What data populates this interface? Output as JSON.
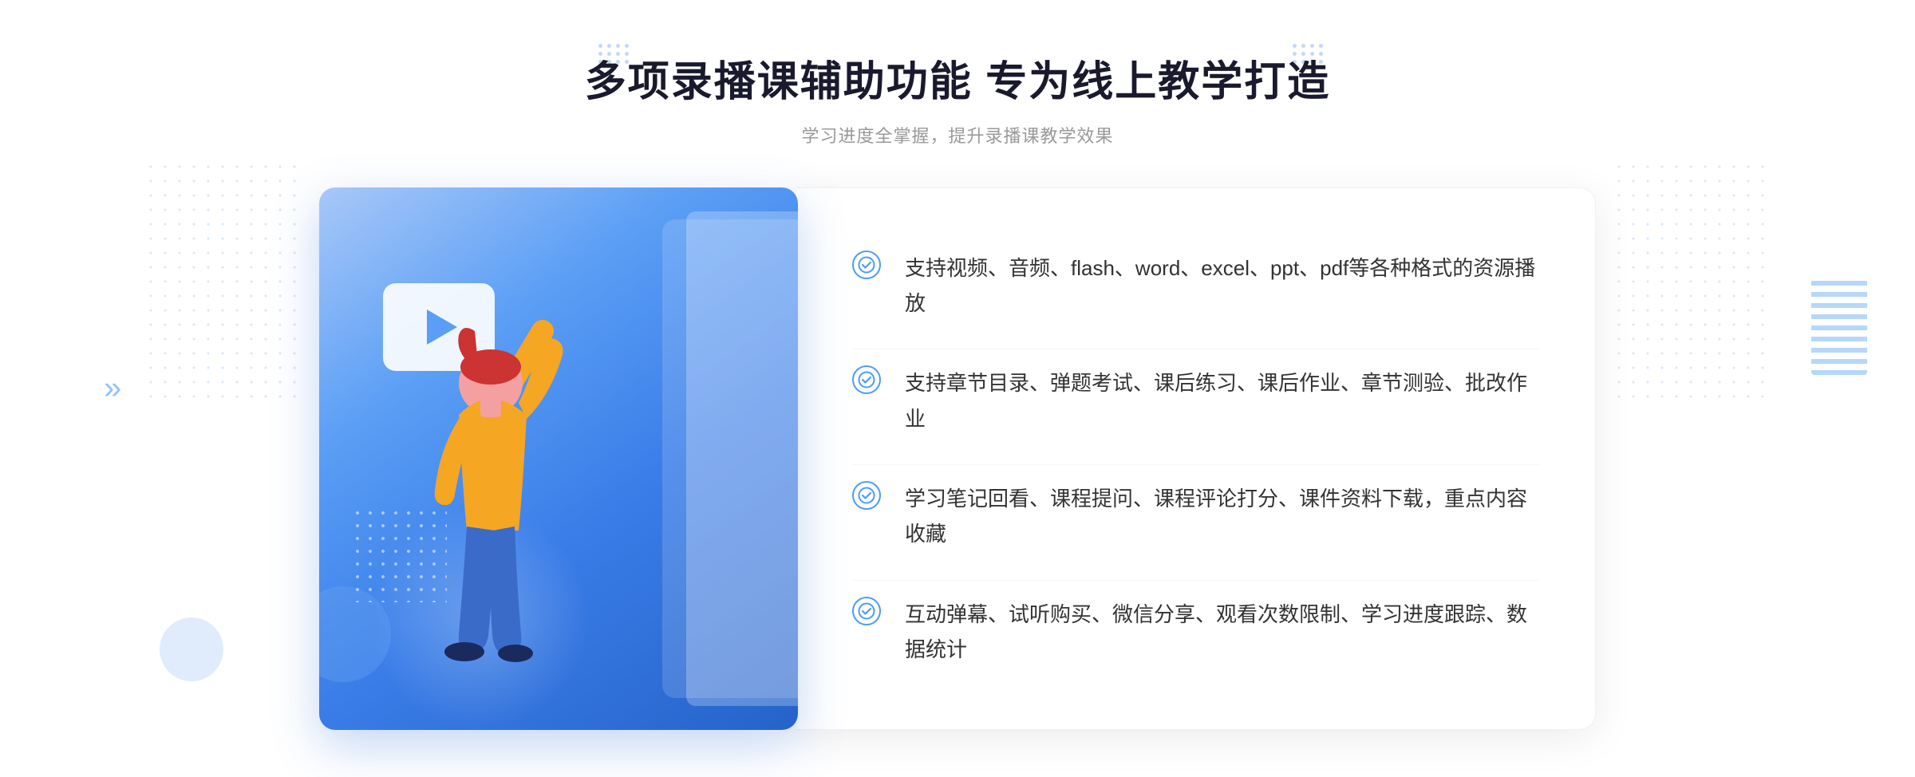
{
  "page": {
    "title": "多项录播课辅助功能 专为线上教学打造",
    "subtitle": "学习进度全掌握，提升录播课教学效果",
    "features": [
      {
        "id": "feature-1",
        "text": "支持视频、音频、flash、word、excel、ppt、pdf等各种格式的资源播放"
      },
      {
        "id": "feature-2",
        "text": "支持章节目录、弹题考试、课后练习、课后作业、章节测验、批改作业"
      },
      {
        "id": "feature-3",
        "text": "学习笔记回看、课程提问、课程评论打分、课件资料下载，重点内容收藏"
      },
      {
        "id": "feature-4",
        "text": "互动弹幕、试听购买、微信分享、观看次数限制、学习进度跟踪、数据统计"
      }
    ],
    "check_icon_symbol": "✓",
    "arrow_symbol": "»",
    "colors": {
      "accent_blue": "#4a9cf6",
      "gradient_start": "#a8c8f8",
      "gradient_end": "#2563c9",
      "title_color": "#1a1a2e",
      "subtitle_color": "#999999",
      "text_color": "#333333"
    }
  }
}
